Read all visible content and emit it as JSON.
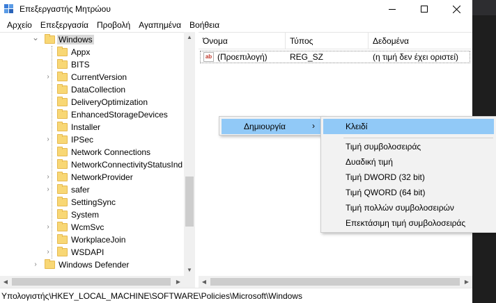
{
  "window": {
    "title": "Επεξεργαστής Μητρώου"
  },
  "menu": [
    "Αρχείο",
    "Επεξεργασία",
    "Προβολή",
    "Αγαπημένα",
    "Βοήθεια"
  ],
  "tree": {
    "items": [
      {
        "label": "Windows",
        "level": 0,
        "expanded": true,
        "selected": true
      },
      {
        "label": "Appx",
        "level": 1,
        "has_children": false
      },
      {
        "label": "BITS",
        "level": 1,
        "has_children": false
      },
      {
        "label": "CurrentVersion",
        "level": 1,
        "has_children": true
      },
      {
        "label": "DataCollection",
        "level": 1,
        "has_children": false
      },
      {
        "label": "DeliveryOptimization",
        "level": 1,
        "has_children": false
      },
      {
        "label": "EnhancedStorageDevices",
        "level": 1,
        "has_children": false
      },
      {
        "label": "Installer",
        "level": 1,
        "has_children": false
      },
      {
        "label": "IPSec",
        "level": 1,
        "has_children": true
      },
      {
        "label": "Network Connections",
        "level": 1,
        "has_children": false
      },
      {
        "label": "NetworkConnectivityStatusInd",
        "level": 1,
        "has_children": false
      },
      {
        "label": "NetworkProvider",
        "level": 1,
        "has_children": true
      },
      {
        "label": "safer",
        "level": 1,
        "has_children": true
      },
      {
        "label": "SettingSync",
        "level": 1,
        "has_children": false
      },
      {
        "label": "System",
        "level": 1,
        "has_children": false
      },
      {
        "label": "WcmSvc",
        "level": 1,
        "has_children": true
      },
      {
        "label": "WorkplaceJoin",
        "level": 1,
        "has_children": false
      },
      {
        "label": "WSDAPI",
        "level": 1,
        "has_children": true
      },
      {
        "label": "Windows Defender",
        "level": 0,
        "has_children": true
      }
    ]
  },
  "list": {
    "columns": [
      "Όνομα",
      "Τύπος",
      "Δεδομένα"
    ],
    "rows": [
      {
        "name": "(Προεπιλογή)",
        "type": "REG_SZ",
        "data": "(η τιμή δεν έχει οριστεί)",
        "icon": "string-value-icon"
      }
    ]
  },
  "context_menu": {
    "main_item": "Δημιουργία",
    "submenu": {
      "key_item": "Κλειδί",
      "items": [
        "Τιμή συμβολοσειράς",
        "Δυαδική τιμή",
        "Τιμή DWORD (32 bit)",
        "Τιμή QWORD (64 bit)",
        "Τιμή πολλών συμβολοσειρών",
        "Επεκτάσιμη τιμή συμβολοσειράς"
      ]
    }
  },
  "status": {
    "path": "Υπολογιστής\\HKEY_LOCAL_MACHINE\\SOFTWARE\\Policies\\Microsoft\\Windows"
  },
  "colors": {
    "highlight": "#91c9f7",
    "folder": "#f8d775"
  }
}
